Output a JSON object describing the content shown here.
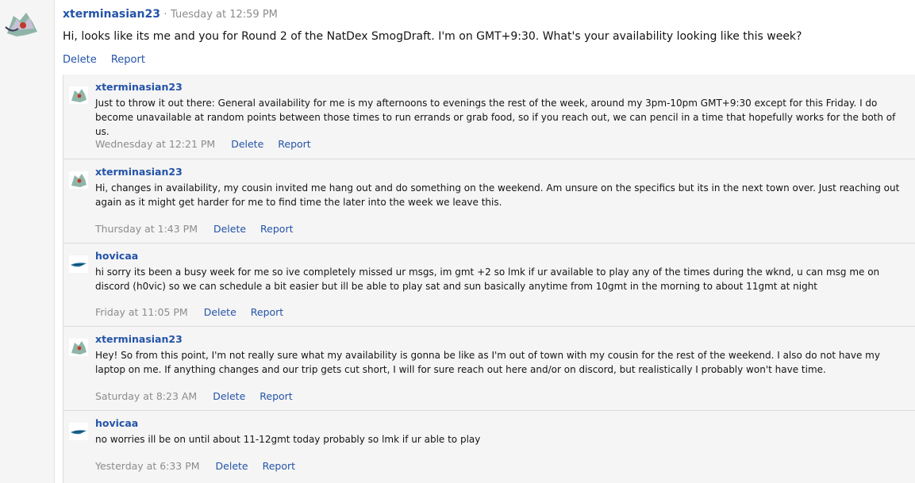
{
  "post": {
    "username": "xterminasian23",
    "separator": "·",
    "timestamp": "Tuesday at 12:59 PM",
    "body": "Hi, looks like its me and you for Round 2 of the NatDex SmogDraft. I'm on GMT+9:30. What's your availability looking like this week?",
    "delete_label": "Delete",
    "report_label": "Report"
  },
  "comments": [
    {
      "username": "xterminasian23",
      "text": "Just to throw it out there: General availability for me is my afternoons to evenings the rest of the week, around my 3pm-10pm GMT+9:30 except for this Friday. I do become unavailable at random points between those times to run errands or grab food, so if you reach out, we can pencil in a time that hopefully works for the both of us.",
      "timestamp": "Wednesday at 12:21 PM",
      "delete_label": "Delete",
      "report_label": "Report"
    },
    {
      "username": "xterminasian23",
      "text": "Hi, changes in availability, my cousin invited me hang out and do something on the weekend. Am unsure on the specifics but its in the next town over. Just reaching out again as it might get harder for me to find time the later into the week we leave this.",
      "timestamp": "Thursday at 1:43 PM",
      "delete_label": "Delete",
      "report_label": "Report"
    },
    {
      "username": "hovicaa",
      "text": "hi sorry its been a busy week for me so ive completely missed ur msgs, im gmt +2 so lmk if ur available to play any of the times during the wknd, u can msg me on discord (h0vic) so we can schedule a bit easier but ill be able to play sat and sun basically anytime from 10gmt in the morning to about 11gmt at night",
      "timestamp": "Friday at 11:05 PM",
      "delete_label": "Delete",
      "report_label": "Report"
    },
    {
      "username": "xterminasian23",
      "text": "Hey! So from this point, I'm not really sure what my availability is gonna be like as I'm out of town with my cousin for the rest of the weekend. I also do not have my laptop on me. If anything changes and our trip gets cut short, I will for sure reach out here and/or on discord, but realistically I probably won't have time.",
      "timestamp": "Saturday at 8:23 AM",
      "delete_label": "Delete",
      "report_label": "Report"
    },
    {
      "username": "hovicaa",
      "text": "no worries ill be on until about 11-12gmt today probably so lmk if ur able to play",
      "timestamp": "Yesterday at 6:33 PM",
      "delete_label": "Delete",
      "report_label": "Report"
    }
  ],
  "colors": {
    "link": "#2453a8",
    "muted": "#8c8c8c",
    "comment_bg": "#f5f5f5"
  }
}
